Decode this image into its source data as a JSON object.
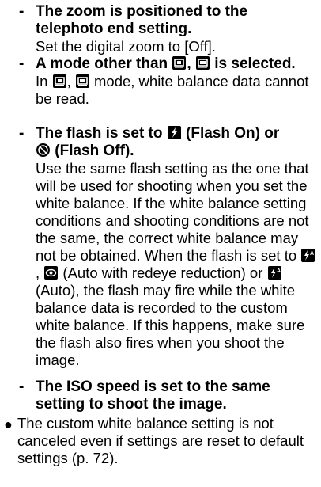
{
  "items": [
    {
      "dash": "-",
      "heading": "The zoom is positioned to the telephoto end setting.",
      "body": "Set the digital zoom to [Off]."
    },
    {
      "dash": "-",
      "heading_a": "A mode other than",
      "heading_sep": ",",
      "heading_b": "is selected.",
      "body_a": "In",
      "body_sep": ",",
      "body_b": "mode, white balance data cannot be read."
    },
    {
      "dash": "-",
      "heading_a": "The flash is set to",
      "heading_b": "(Flash On) or",
      "heading_c": "(Flash Off).",
      "body_a": "Use the same flash setting as the one that will be used for shooting when you set the white balance. If the white balance setting conditions and shooting conditions are not the same, the correct white balance may not be obtained. When the flash is set to",
      "body_b": ",",
      "body_c": "(Auto with redeye reduction) or",
      "body_d": "(Auto), the flash may fire while the white balance data is recorded to the custom white balance. If this happens, make sure the flash also fires when you shoot the image."
    },
    {
      "dash": "-",
      "heading": "The ISO speed is set to the same setting to shoot the image."
    }
  ],
  "bullet": {
    "symbol": "●",
    "text": "The custom white balance setting is not canceled even if settings are reset to default settings (p. 72)."
  },
  "icons": {
    "scene_mode_a": "scene-mode-icon",
    "scene_mode_b": "scene-mode-alt-icon",
    "flash_on": "flash-on-icon",
    "flash_off": "flash-off-icon",
    "flash_auto": "flash-auto-icon",
    "redeye": "redeye-icon",
    "flash_auto_b": "flash-auto-icon"
  },
  "colors": {
    "text": "#000000",
    "background": "#ffffff",
    "icon_bg": "#000000",
    "icon_fg": "#ffffff"
  }
}
